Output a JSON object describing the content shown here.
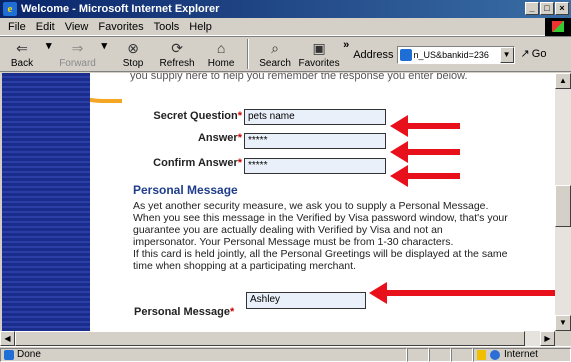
{
  "window": {
    "title": "Welcome - Microsoft Internet Explorer",
    "buttons": [
      "_",
      "□",
      "×"
    ]
  },
  "menu": [
    {
      "label": "File"
    },
    {
      "label": "Edit"
    },
    {
      "label": "View"
    },
    {
      "label": "Favorites"
    },
    {
      "label": "Tools"
    },
    {
      "label": "Help"
    }
  ],
  "toolbar": {
    "back": "Back",
    "forward": "Forward",
    "stop": "Stop",
    "refresh": "Refresh",
    "home": "Home",
    "search": "Search",
    "favorites": "Favorites",
    "more": "»",
    "address_label": "Address",
    "address_value": "n_US&bankid=236",
    "go": "Go"
  },
  "page": {
    "top_text": "you supply here to help you remember the response you enter below.",
    "secret_question_label": "Secret Question",
    "secret_question_value": "pets name",
    "answer_label": "Answer",
    "answer_value": "*****",
    "confirm_answer_label": "Confirm Answer",
    "confirm_answer_value": "*****",
    "required_mark": "*",
    "section_title": "Personal Message",
    "paragraph_lines": [
      "As yet another security measure, we ask you to supply a Personal Message.",
      "When you see this message in the Verified by Visa password window, that's your",
      "guarantee you are actually dealing with Verified by Visa and not an",
      "impersonator. Your Personal Message must be from 1-30 characters.",
      "If this card is held jointly, all the Personal Greetings will be displayed at the same",
      "time when shopping at a participating merchant."
    ],
    "personal_message_label": "Personal Message",
    "personal_message_value": "Ashley"
  },
  "status": {
    "text": "Done",
    "zone": "Internet"
  },
  "colors": {
    "accent_red": "#e8101a",
    "section_blue": "#1f3d8a",
    "sidebar_blue": "#1a2c8c",
    "orange": "#f5a623"
  }
}
